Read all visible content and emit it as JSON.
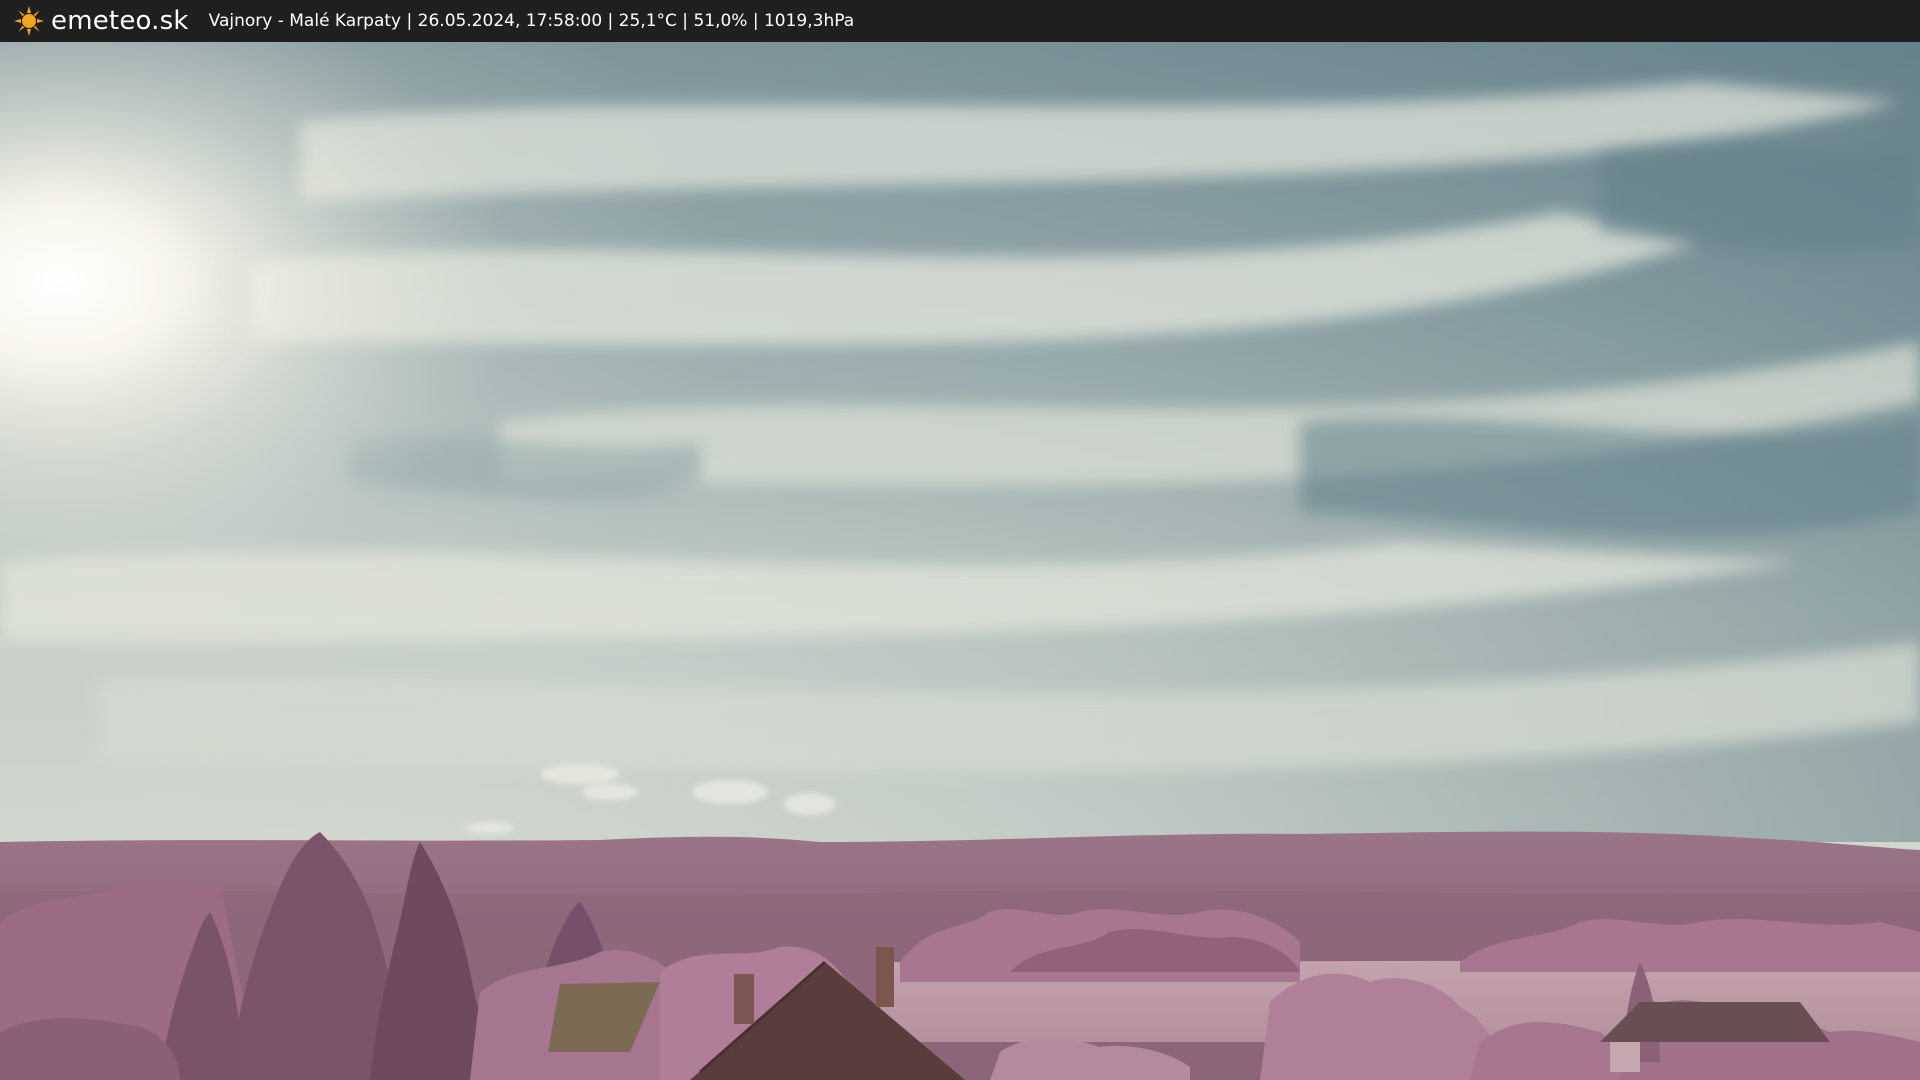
{
  "header": {
    "logo_icon": "sun-icon",
    "logo_text": "emeteo.sk",
    "caption": "Vajnory - Malé Karpaty | 26.05.2024, 17:58:00 | 25,1°C | 51,0% | 1019,3hPa"
  },
  "colors": {
    "bar_background": "#1f1f1f",
    "logo_sun": "#f2a51f",
    "sky_upper": "#6f8a91",
    "sky_haze": "#d9ddd2",
    "vegetation": "#a8728f"
  }
}
